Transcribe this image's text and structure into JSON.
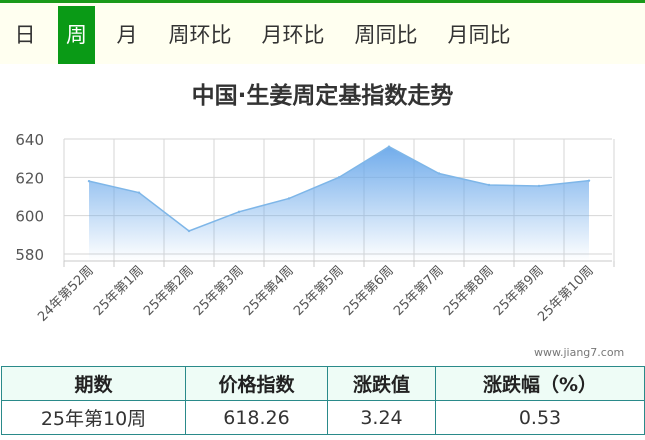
{
  "tabs": [
    {
      "label": "日",
      "active": false
    },
    {
      "label": "周",
      "active": true
    },
    {
      "label": "月",
      "active": false
    },
    {
      "label": "周环比",
      "active": false
    },
    {
      "label": "月环比",
      "active": false
    },
    {
      "label": "周同比",
      "active": false
    },
    {
      "label": "月同比",
      "active": false
    }
  ],
  "colors": {
    "tab_active": "#0a9a16",
    "tab_bar_bg": "#fffff0",
    "series_line": "#7eb6e8",
    "series_fill": "#6aa8ea",
    "table_border": "#2a8a8a",
    "table_header_bg": "#eefcf6"
  },
  "chart_data": {
    "type": "area",
    "title": "中国·生姜周定基指数走势",
    "xlabel": "",
    "ylabel": "",
    "categories": [
      "24年第52周",
      "25年第1周",
      "25年第2周",
      "25年第3周",
      "25年第4周",
      "25年第5周",
      "25年第6周",
      "25年第7周",
      "25年第8周",
      "25年第9周",
      "25年第10周"
    ],
    "series": [
      {
        "values": [
          618,
          612,
          592,
          602,
          609,
          620,
          636,
          622,
          616,
          615.5,
          618.26
        ]
      }
    ],
    "ylim": [
      580,
      640
    ],
    "yticks": [
      580,
      600,
      620,
      640
    ],
    "grid": true,
    "legend": "none"
  },
  "watermark": "www.jiang7.com",
  "table": {
    "headers": [
      "期数",
      "价格指数",
      "涨跌值",
      "涨跌幅（%）"
    ],
    "rows": [
      [
        "25年第10周",
        "618.26",
        "3.24",
        "0.53"
      ]
    ]
  }
}
